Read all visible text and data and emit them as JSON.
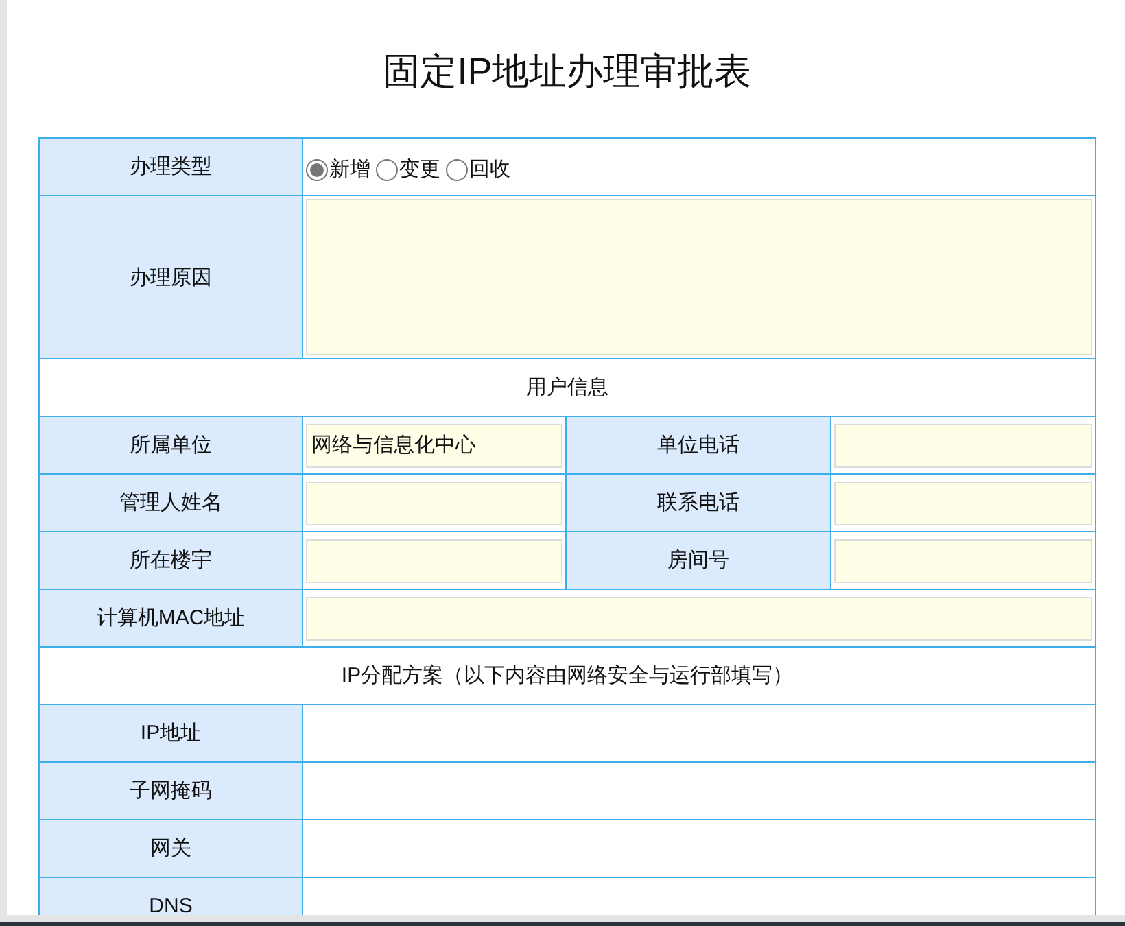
{
  "title": "固定IP地址办理审批表",
  "rows": [
    {
      "kind": "radio",
      "label": "办理类型",
      "options": [
        {
          "label": "新增",
          "selected": true
        },
        {
          "label": "变更",
          "selected": false
        },
        {
          "label": "回收",
          "selected": false
        }
      ]
    },
    {
      "kind": "textarea",
      "label": "办理原因"
    },
    {
      "kind": "heading",
      "text": "用户信息"
    },
    {
      "kind": "pair",
      "cells": [
        {
          "label": "所属单位",
          "value": "网络与信息化中心"
        },
        {
          "label": "单位电话"
        }
      ]
    },
    {
      "kind": "pair",
      "cells": [
        {
          "label": "管理人姓名"
        },
        {
          "label": "联系电话"
        }
      ]
    },
    {
      "kind": "pair",
      "cells": [
        {
          "label": "所在楼宇"
        },
        {
          "label": "房间号"
        }
      ]
    },
    {
      "kind": "wide",
      "label": "计算机MAC地址"
    },
    {
      "kind": "heading",
      "text": "IP分配方案（以下内容由网络安全与运行部填写）"
    },
    {
      "kind": "plain",
      "label": "IP地址"
    },
    {
      "kind": "plain",
      "label": "子网掩码"
    },
    {
      "kind": "plain",
      "label": "网关"
    },
    {
      "kind": "plain",
      "label": "DNS"
    }
  ]
}
